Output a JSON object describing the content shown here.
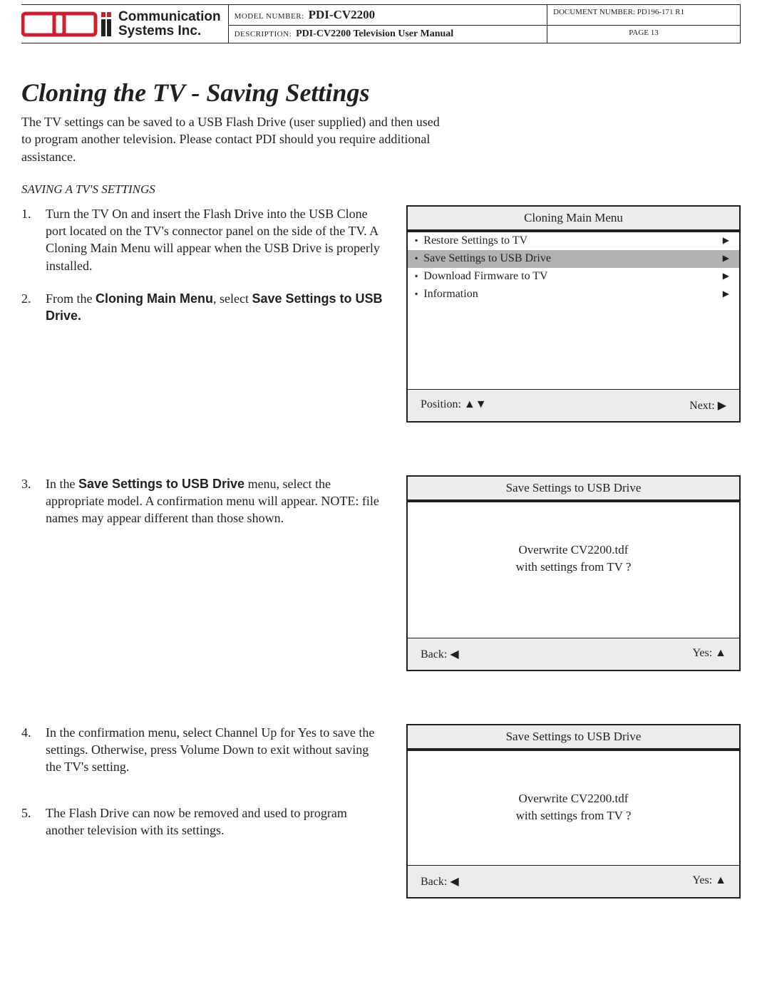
{
  "header": {
    "company_line1": "Communication",
    "company_line2": "Systems Inc.",
    "model_label": "MODEL NUMBER:",
    "model_value": "PDI-CV2200",
    "doc_label": "DOCUMENT NUMBER:",
    "doc_value": "PD196-171 R1",
    "desc_label": "DESCRIPTION:",
    "desc_value": "PDI-CV2200 Television User Manual",
    "page_label": "PAGE 13"
  },
  "title": "Cloning the TV - Saving Settings",
  "intro": "The TV settings can be saved to a USB Flash Drive (user supplied) and then used to program another television.  Please contact PDI should you require additional assistance.",
  "subhead": "SAVING A TV'S SETTINGS",
  "steps": {
    "s1": "Turn the TV On and insert the Flash Drive into the USB Clone port located on the TV's connector panel on the side of the TV.  A Cloning Main Menu will appear when the USB Drive is properly installed.",
    "s2_a": "From the ",
    "s2_b": "Cloning Main Menu",
    "s2_c": ", select ",
    "s2_d": "Save Settings to USB Drive.",
    "s3_a": "In the ",
    "s3_b": "Save Settings to USB Drive",
    "s3_c": " menu, select the appropriate model.  A confirmation menu will appear.  NOTE: file names may appear different than those shown.",
    "s4": "In the confirmation menu, select Channel Up for Yes to save the settings.  Otherwise, press Volume Down to exit without saving the TV's setting.",
    "s5": "The Flash Drive can now be removed and used to program another television with its settings."
  },
  "menu1": {
    "title": "Cloning Main Menu",
    "items": [
      {
        "label": "Restore Settings to TV"
      },
      {
        "label": "Save Settings to USB Drive"
      },
      {
        "label": "Download Firmware to TV"
      },
      {
        "label": "Information"
      }
    ],
    "footer_left": "Position: ▲▼",
    "footer_right": "Next: ▶"
  },
  "menu2": {
    "title": "Save Settings to USB Drive",
    "msg_line1": "Overwrite CV2200.tdf",
    "msg_line2": "with settings from TV ?",
    "footer_left": "Back: ◀",
    "footer_right": "Yes: ▲"
  },
  "menu3": {
    "title": "Save Settings to USB Drive",
    "msg_line1": "Overwrite CV2200.tdf",
    "msg_line2": "with settings from TV ?",
    "footer_left": "Back: ◀",
    "footer_right": "Yes: ▲"
  }
}
